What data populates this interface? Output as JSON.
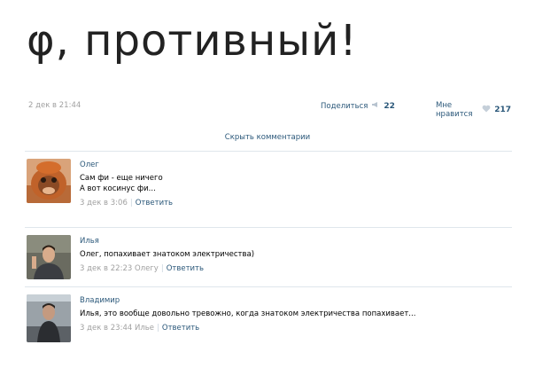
{
  "post": {
    "title": "φ, противный!",
    "date": "2 дек в 21:44",
    "share_label": "Поделиться",
    "share_count": "22",
    "like_label": "Мне нравится",
    "like_count": "217",
    "hide_comments": "Скрыть комментарии",
    "share_icon": "megaphone-icon",
    "like_icon": "heart-icon"
  },
  "comments": [
    {
      "author": "Олег",
      "lines": [
        "Сам фи - еще ничего",
        "А вот косинус фи..."
      ],
      "time": "3 дек в 3:06",
      "to": "",
      "reply": "Ответить"
    },
    {
      "author": "Илья",
      "lines": [
        "Олег, попахивает знатоком электричества)"
      ],
      "time": "3 дек в 22:23",
      "to": "Олегу",
      "reply": "Ответить"
    },
    {
      "author": "Владимир",
      "lines": [
        "Илья, это вообще довольно тревожно, когда знатоком электричества попахивает..."
      ],
      "time": "3 дек в 23:44",
      "to": "Илье",
      "reply": "Ответить"
    }
  ],
  "colors": {
    "link": "#2b587a",
    "muted": "#a0a0a0",
    "divider": "#dfe6ec"
  }
}
